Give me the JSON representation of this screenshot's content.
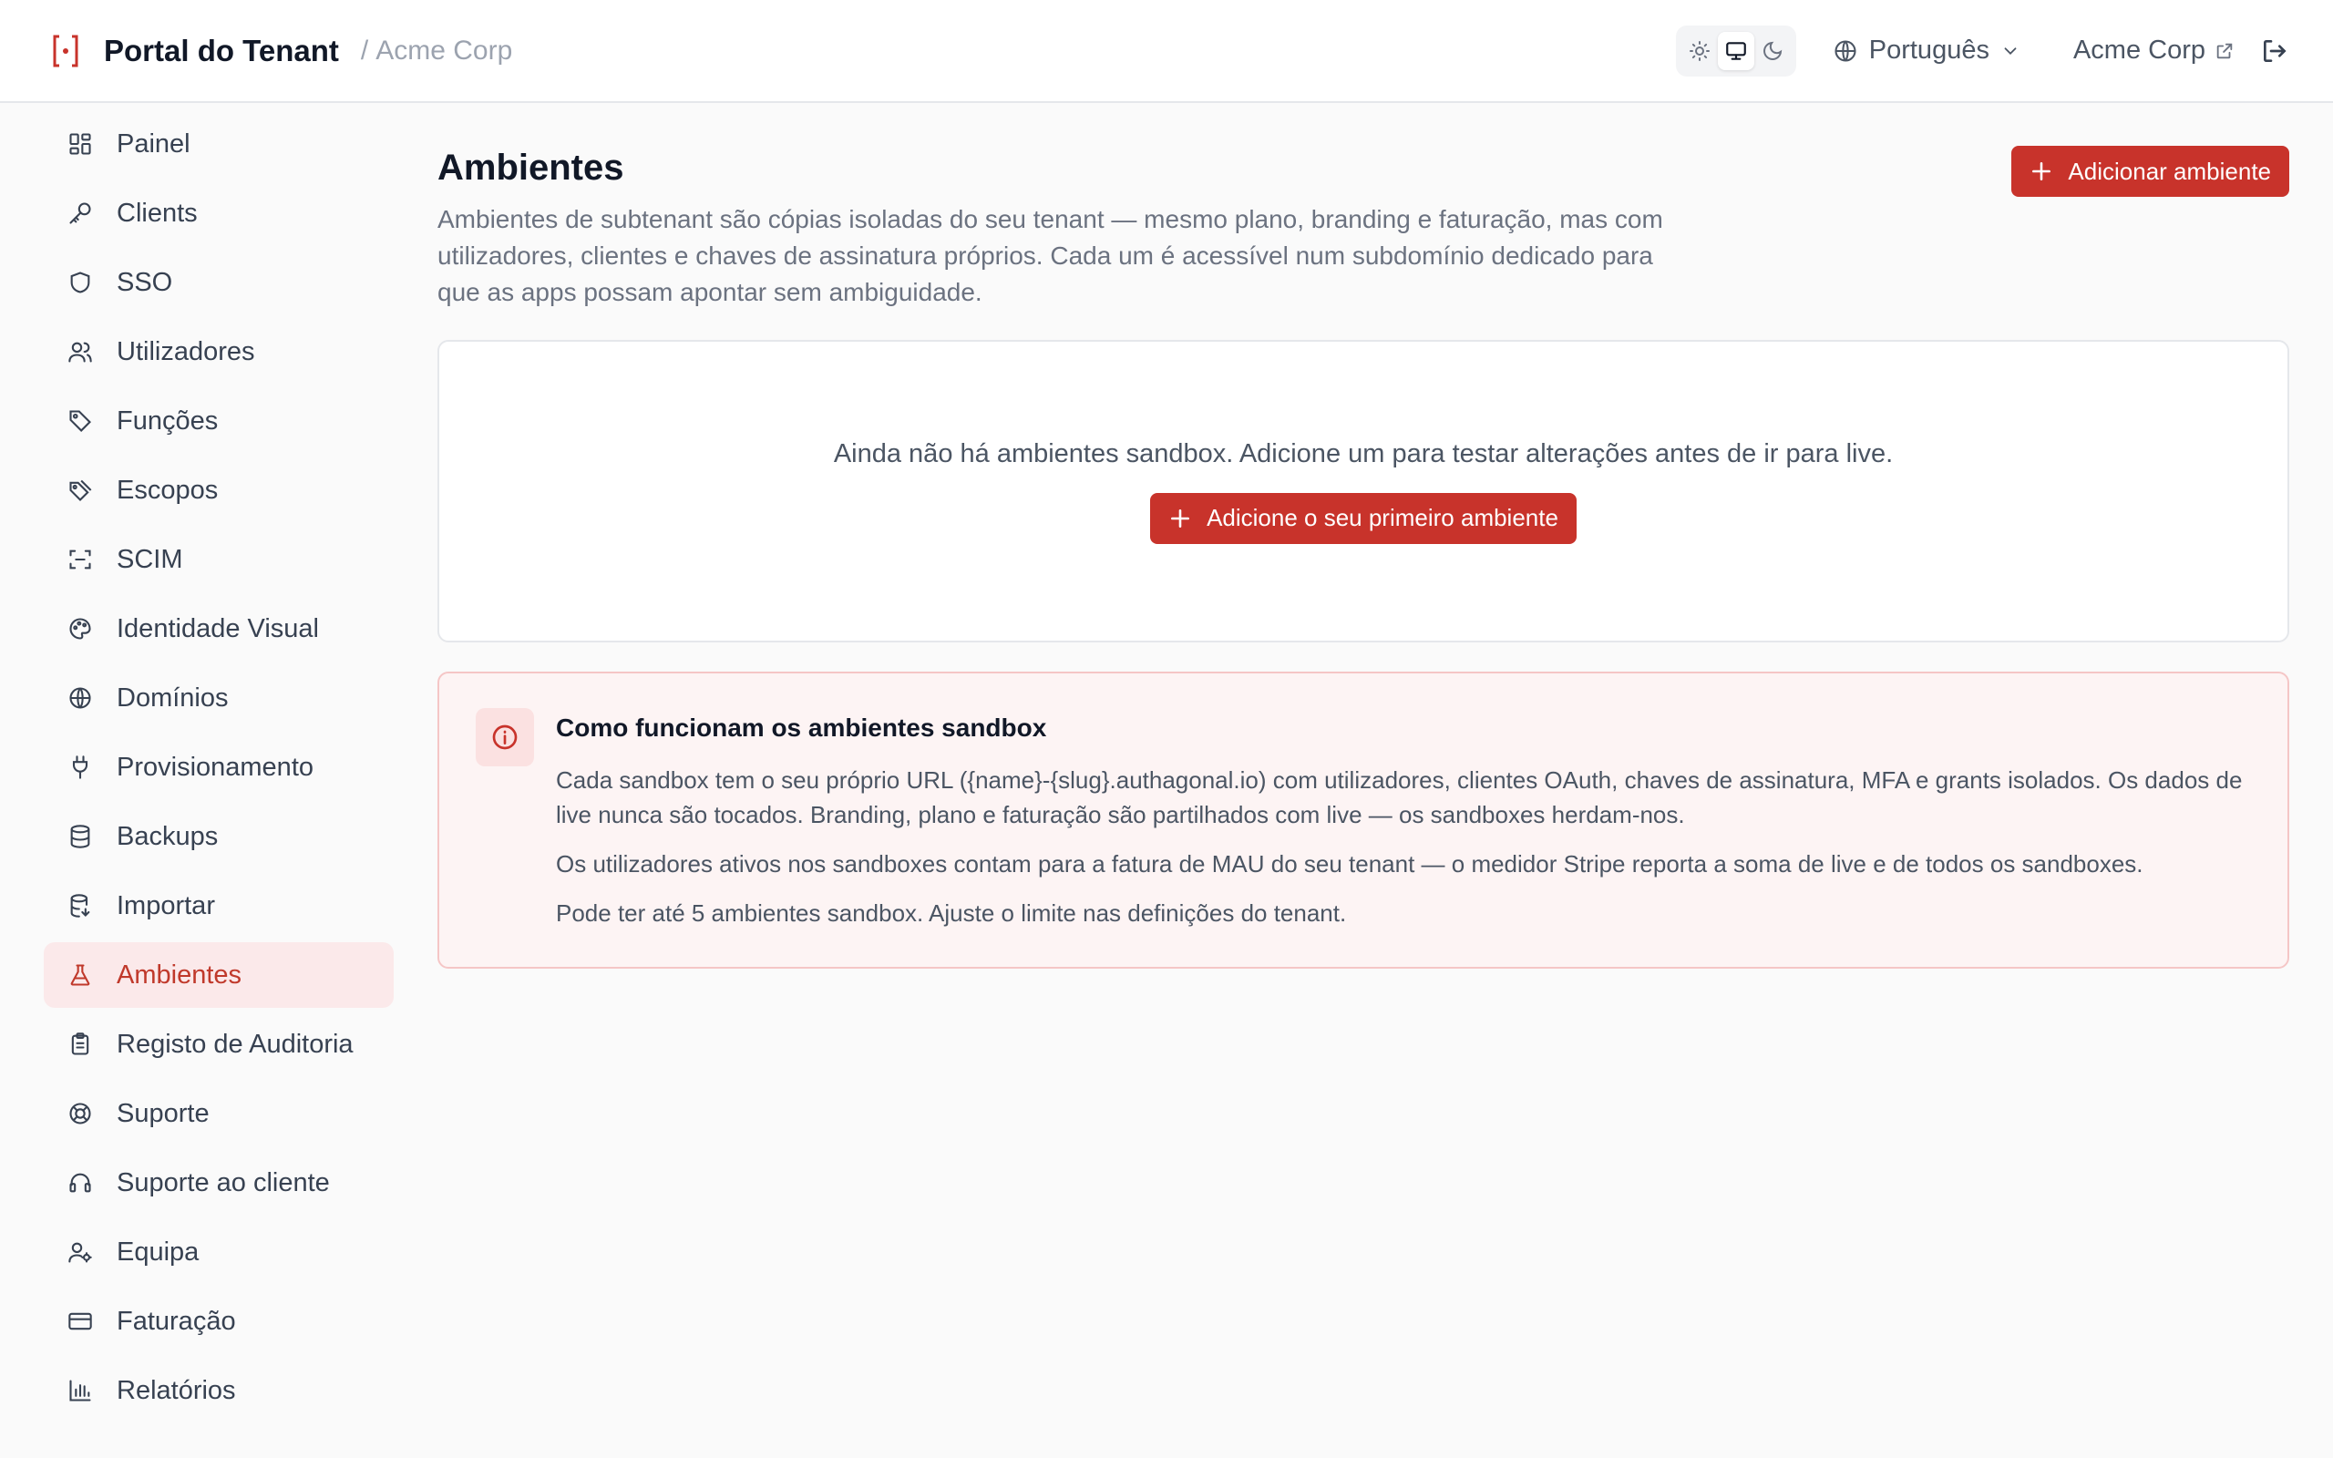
{
  "header": {
    "title": "Portal do Tenant",
    "separator": "/",
    "tenant": "Acme Corp",
    "language": "Português",
    "tenant_link": "Acme Corp",
    "theme_modes": [
      "sun-icon",
      "monitor-icon",
      "moon-icon"
    ],
    "active_theme": "monitor"
  },
  "sidebar": {
    "items": [
      {
        "label": "Painel",
        "icon": "dashboard-icon"
      },
      {
        "label": "Clients",
        "icon": "key-icon"
      },
      {
        "label": "SSO",
        "icon": "shield-icon"
      },
      {
        "label": "Utilizadores",
        "icon": "users-icon"
      },
      {
        "label": "Funções",
        "icon": "tag-icon"
      },
      {
        "label": "Escopos",
        "icon": "tags-icon"
      },
      {
        "label": "SCIM",
        "icon": "scan-icon"
      },
      {
        "label": "Identidade Visual",
        "icon": "palette-icon"
      },
      {
        "label": "Domínios",
        "icon": "globe-icon"
      },
      {
        "label": "Provisionamento",
        "icon": "plug-icon"
      },
      {
        "label": "Backups",
        "icon": "database-icon"
      },
      {
        "label": "Importar",
        "icon": "database-import-icon"
      },
      {
        "label": "Ambientes",
        "icon": "flask-icon"
      },
      {
        "label": "Registo de Auditoria",
        "icon": "clipboard-icon"
      },
      {
        "label": "Suporte",
        "icon": "lifebuoy-icon"
      },
      {
        "label": "Suporte ao cliente",
        "icon": "headset-icon"
      },
      {
        "label": "Equipa",
        "icon": "user-cog-icon"
      },
      {
        "label": "Faturação",
        "icon": "credit-card-icon"
      },
      {
        "label": "Relatórios",
        "icon": "bar-chart-icon"
      }
    ],
    "active": "Ambientes"
  },
  "main": {
    "title": "Ambientes",
    "description": "Ambientes de subtenant são cópias isoladas do seu tenant — mesmo plano, branding e faturação, mas com utilizadores, clientes e chaves de assinatura próprios. Cada um é acessível num subdomínio dedicado para que as apps possam apontar sem ambiguidade.",
    "add_button": "Adicionar ambiente",
    "empty": {
      "text": "Ainda não há ambientes sandbox. Adicione um para testar alterações antes de ir para live.",
      "button": "Adicione o seu primeiro ambiente"
    },
    "info": {
      "title": "Como funcionam os ambientes sandbox",
      "p1": "Cada sandbox tem o seu próprio URL ({name}-{slug}.authagonal.io) com utilizadores, clientes OAuth, chaves de assinatura, MFA e grants isolados. Os dados de live nunca são tocados. Branding, plano e faturação são partilhados com live — os sandboxes herdam-nos.",
      "p2": "Os utilizadores ativos nos sandboxes contam para a fatura de MAU do seu tenant — o medidor Stripe reporta a soma de live e de todos os sandboxes.",
      "p3": "Pode ter até 5 ambientes sandbox. Ajuste o limite nas definições do tenant."
    }
  },
  "colors": {
    "accent": "#c8332b",
    "active_bg": "#fbe9ea",
    "info_bg": "#fdf4f4",
    "info_border": "#f5c6c6"
  }
}
